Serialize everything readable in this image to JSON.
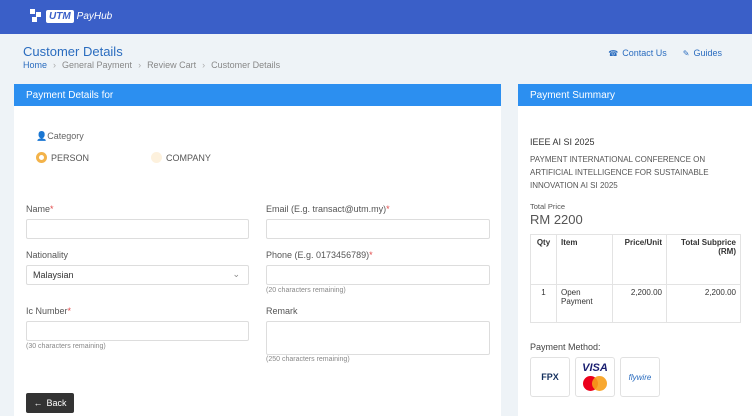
{
  "header": {
    "logo_box": "UTM",
    "logo_text": "PayHub"
  },
  "page": {
    "title": "Customer Details",
    "breadcrumb": [
      "Home",
      "General Payment",
      "Review Cart",
      "Customer Details"
    ],
    "links": {
      "contact": "Contact Us",
      "guides": "Guides"
    }
  },
  "payment_details": {
    "heading": "Payment Details for",
    "category_label": "Category",
    "options": [
      "PERSON",
      "COMPANY"
    ],
    "selected_option": "PERSON",
    "fields": {
      "name": {
        "label": "Name",
        "value": ""
      },
      "email": {
        "label": "Email (E.g. transact@utm.my)",
        "value": ""
      },
      "nationality": {
        "label": "Nationality",
        "value": "Malaysian"
      },
      "phone": {
        "label": "Phone (E.g. 0173456789)",
        "value": "",
        "hint": "(20 characters remaining)"
      },
      "ic": {
        "label": "Ic Number",
        "value": "",
        "hint": "(30 characters remaining)"
      },
      "remark": {
        "label": "Remark",
        "value": "",
        "hint": "(250 characters remaining)"
      }
    },
    "back_label": "Back",
    "required_mark": "*"
  },
  "summary": {
    "heading": "Payment Summary",
    "item_title": "IEEE AI SI 2025",
    "item_desc": "PAYMENT INTERNATIONAL CONFERENCE ON ARTIFICIAL INTELLIGENCE FOR SUSTAINABLE INNOVATION AI SI 2025",
    "total_label": "Total Price",
    "total_value": "RM 2200",
    "columns": [
      "Qty",
      "Item",
      "Price/Unit",
      "Total Subprice (RM)"
    ],
    "rows": [
      {
        "qty": "1",
        "item": "Open Payment",
        "price": "2,200.00",
        "subtotal": "2,200.00"
      }
    ],
    "method_label": "Payment Method:",
    "methods": {
      "fpx": "FPX",
      "visa": "VISA",
      "flywire": "flywire"
    }
  },
  "colors": {
    "header": "#3a5fc8",
    "card_header": "#2c8ff0",
    "accent": "#2a6cbf",
    "radio": "#f3b34a"
  }
}
